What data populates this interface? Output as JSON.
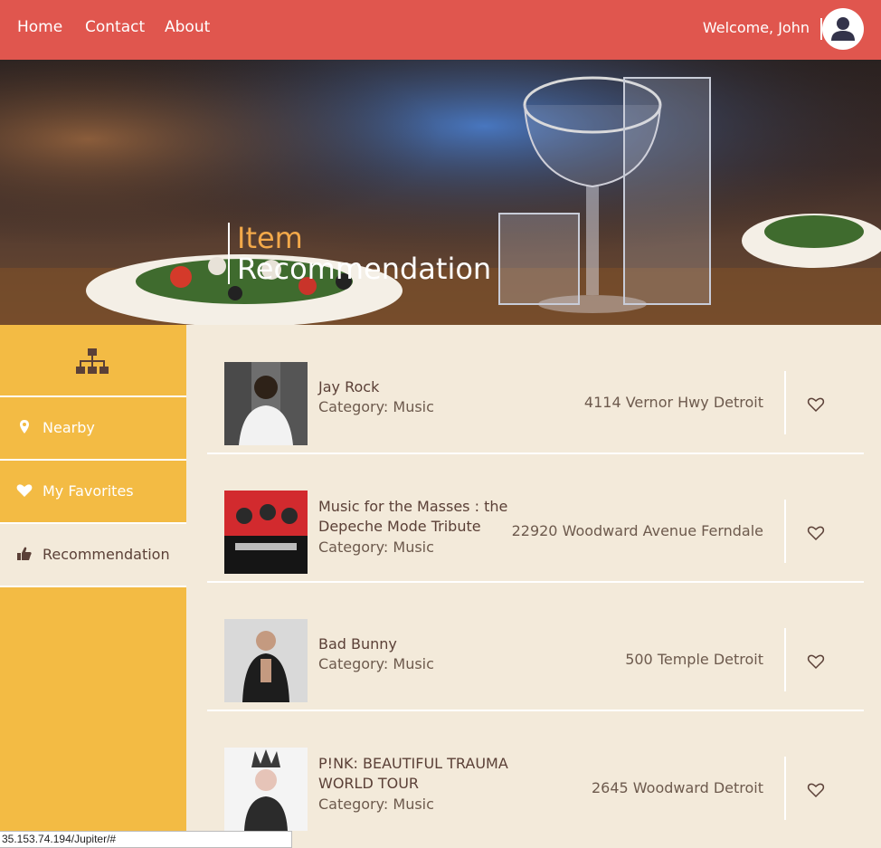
{
  "nav": {
    "links": [
      "Home",
      "Contact",
      "About"
    ],
    "welcome": "Welcome, John"
  },
  "hero": {
    "line1": "Item",
    "line2": "Recommendation"
  },
  "sidebar": {
    "items": [
      {
        "label": "Nearby",
        "icon": "map-pin-icon"
      },
      {
        "label": "My Favorites",
        "icon": "heart-icon"
      },
      {
        "label": "Recommendation",
        "icon": "thumbs-up-icon",
        "active": true
      }
    ]
  },
  "items": [
    {
      "name": "Jay Rock",
      "category": "Category: Music",
      "address": "4114 Vernor Hwy Detroit"
    },
    {
      "name": "Music for the Masses : the Depeche Mode Tribute",
      "category": "Category: Music",
      "address": "22920 Woodward Avenue Ferndale"
    },
    {
      "name": "Bad Bunny",
      "category": "Category: Music",
      "address": "500 Temple Detroit"
    },
    {
      "name": "P!NK: BEAUTIFUL TRAUMA WORLD TOUR",
      "category": "Category: Music",
      "address": "2645 Woodward Detroit"
    }
  ],
  "status_url": "35.153.74.194/Jupiter/#",
  "colors": {
    "nav": "#e0564e",
    "sidebar": "#f3bb44",
    "content_bg": "#f3eada",
    "accent": "#f3a94a"
  }
}
